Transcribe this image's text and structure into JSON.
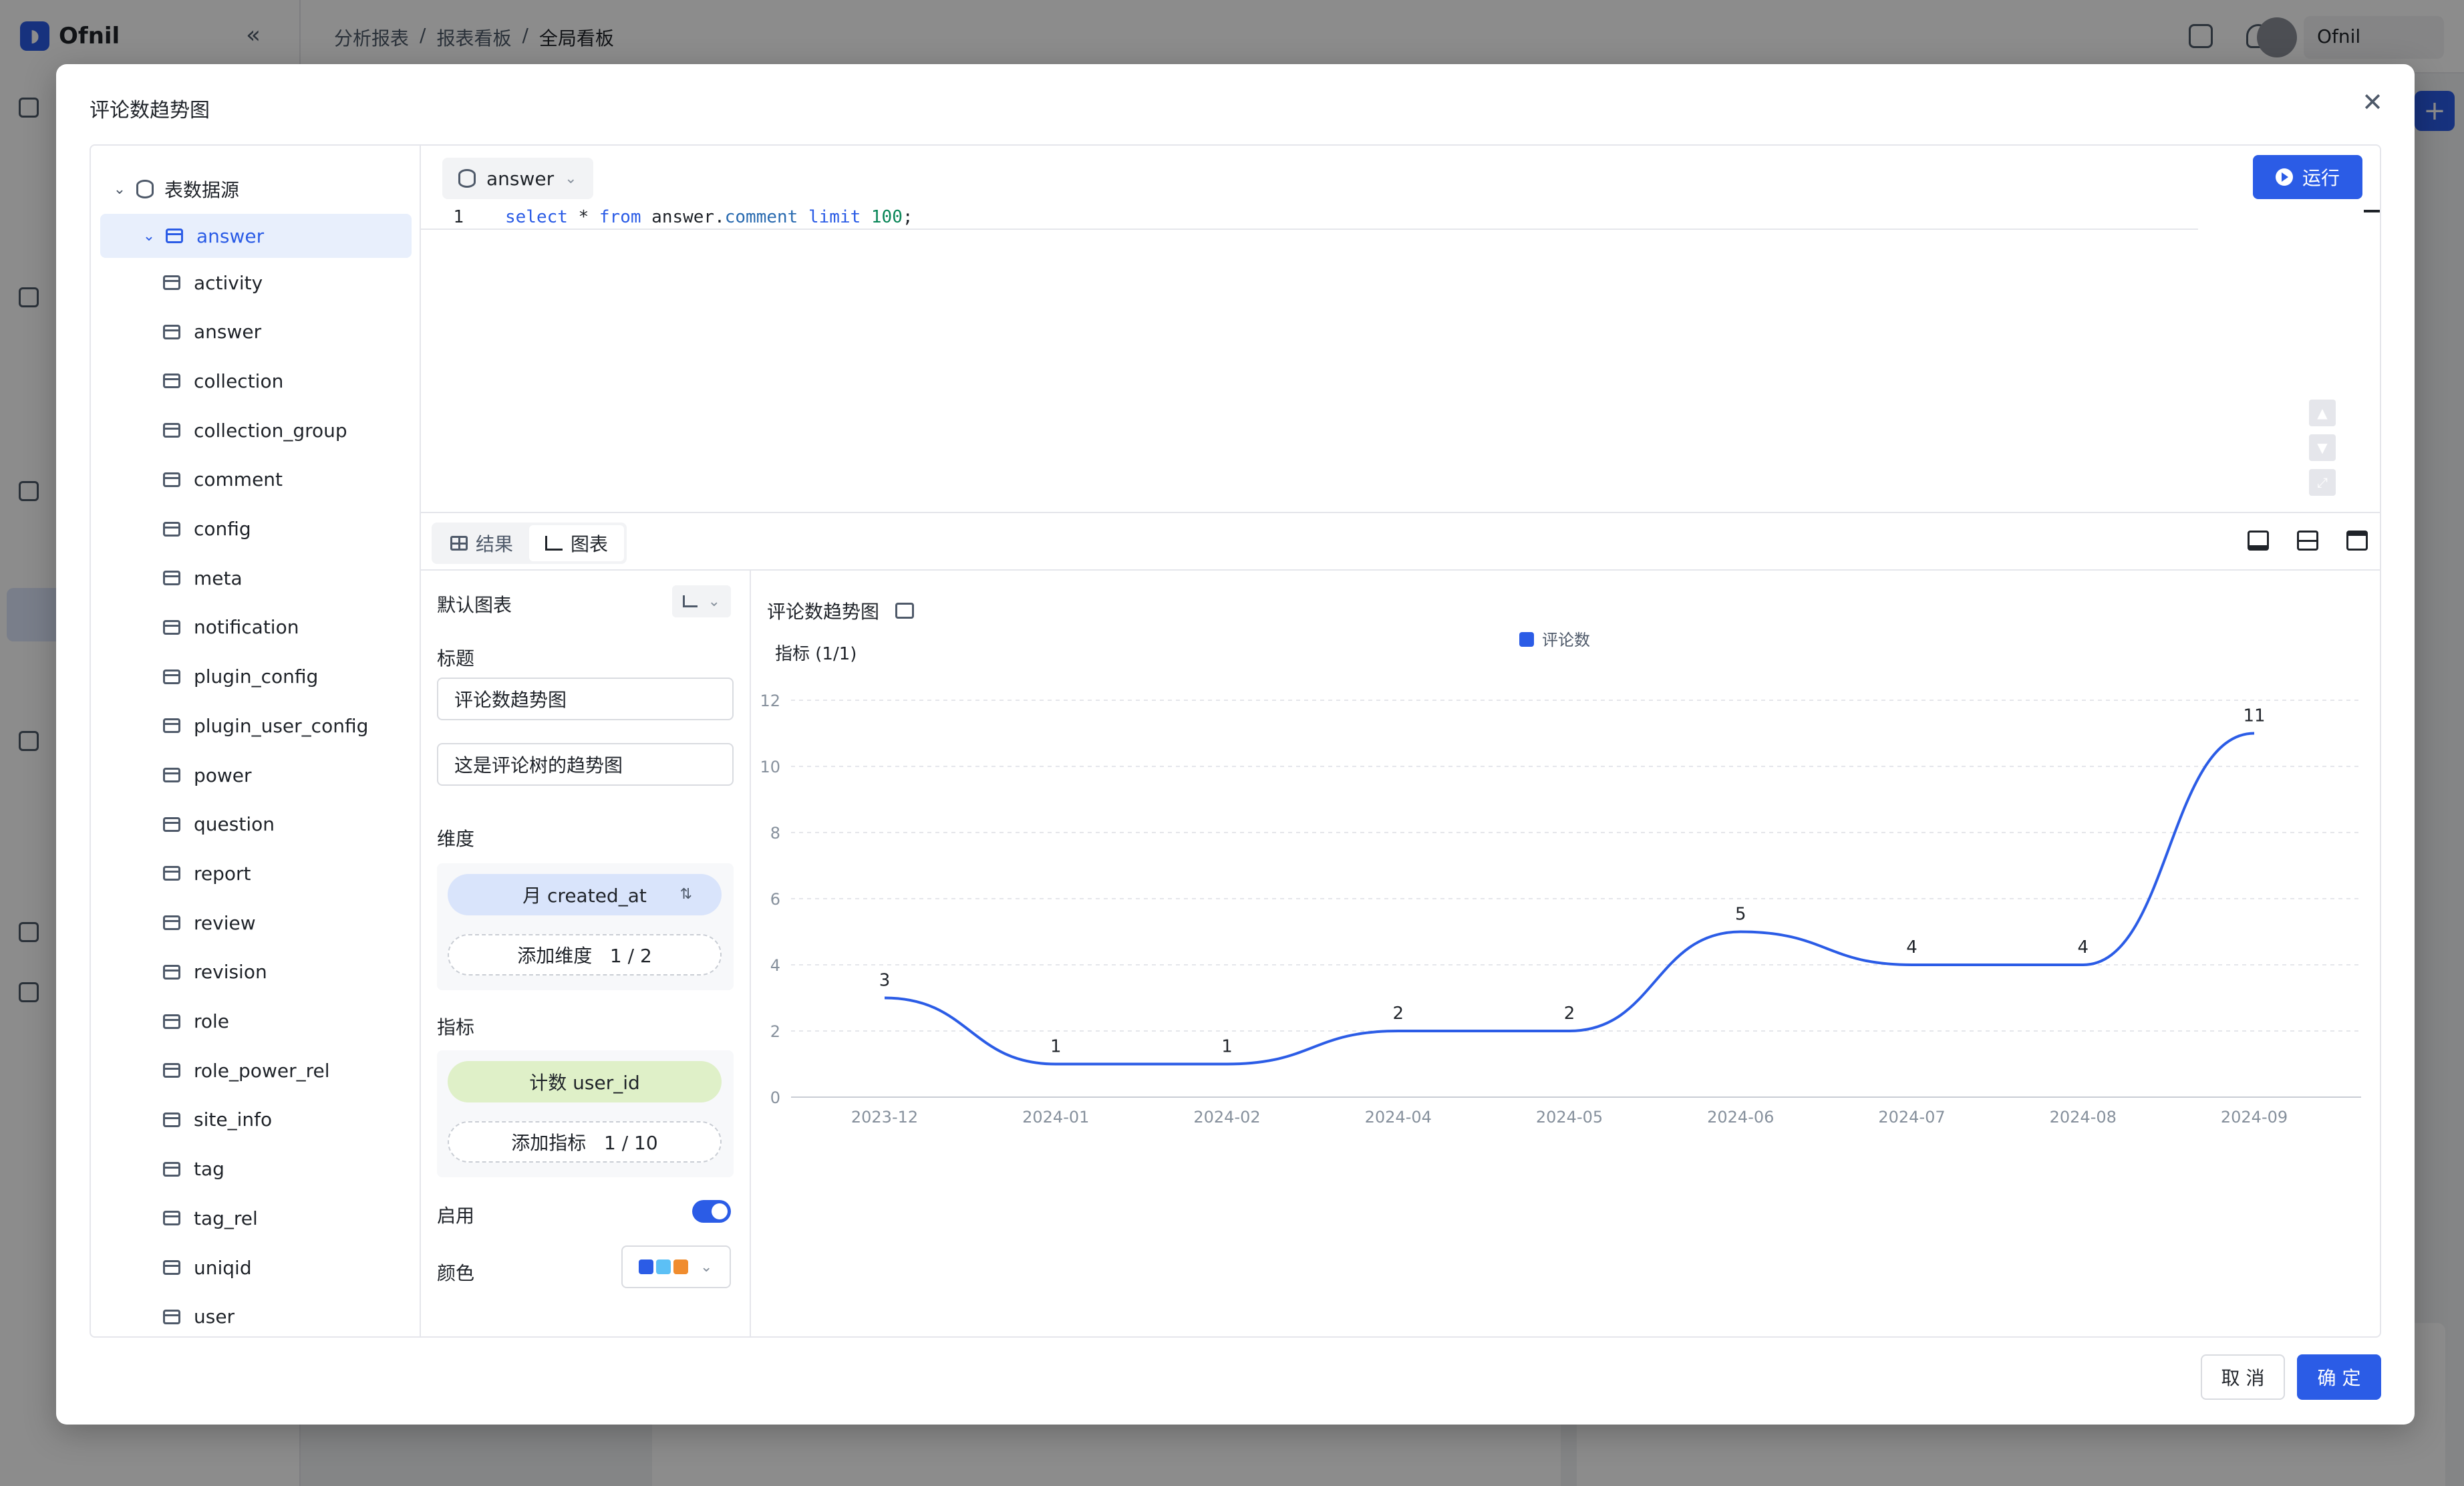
{
  "app": {
    "brand": "Ofnil",
    "breadcrumbs": [
      "分析报表",
      "/",
      "报表看板",
      "/",
      "全局看板"
    ],
    "user_name": "Ofnil"
  },
  "modal": {
    "title": "评论数趋势图",
    "cancel_label": "取 消",
    "ok_label": "确 定"
  },
  "tree": {
    "root_label": "表数据源",
    "selected_db": "answer",
    "tables": [
      "activity",
      "answer",
      "collection",
      "collection_group",
      "comment",
      "config",
      "meta",
      "notification",
      "plugin_config",
      "plugin_user_config",
      "power",
      "question",
      "report",
      "review",
      "revision",
      "role",
      "role_power_rel",
      "site_info",
      "tag",
      "tag_rel",
      "uniqid",
      "user"
    ]
  },
  "editor": {
    "db_select": "answer",
    "run_label": "运行",
    "line_number": "1",
    "sql": {
      "kw1": "select",
      "star": " * ",
      "kw2": "from",
      "table": " answer.",
      "field": "comment",
      "kw3": " limit ",
      "limit": "100",
      "end": ";"
    }
  },
  "tabs": {
    "result_label": "结果",
    "chart_label": "图表"
  },
  "config": {
    "default_chart_label": "默认图表",
    "title_label": "标题",
    "title_value": "评论数趋势图",
    "subtitle_value": "这是评论树的趋势图",
    "dimension_label": "维度",
    "dimension_pill": "月 created_at",
    "add_dimension": "添加维度   1 / 2",
    "metric_label": "指标",
    "metric_pill": "计数 user_id",
    "add_metric": "添加指标   1 / 10",
    "enable_label": "启用",
    "color_label": "颜色",
    "palette": [
      "#2b5ce6",
      "#5cc0f5",
      "#f08c2e"
    ]
  },
  "chart_meta": {
    "title": "评论数趋势图",
    "metric_tag": "指标 (1/1)"
  },
  "chart_data": {
    "type": "line",
    "title": "评论数趋势图",
    "categories": [
      "2023-12",
      "2024-01",
      "2024-02",
      "2024-04",
      "2024-05",
      "2024-06",
      "2024-07",
      "2024-08",
      "2024-09"
    ],
    "series": [
      {
        "name": "评论数",
        "values": [
          3,
          1,
          1,
          2,
          2,
          5,
          4,
          4,
          11
        ],
        "color": "#2b5ce6"
      }
    ],
    "ylim": [
      0,
      12
    ],
    "yticks": [
      0,
      2,
      4,
      6,
      8,
      10,
      12
    ],
    "legend": "top-center",
    "grid": true,
    "smooth": true,
    "data_labels": true
  }
}
